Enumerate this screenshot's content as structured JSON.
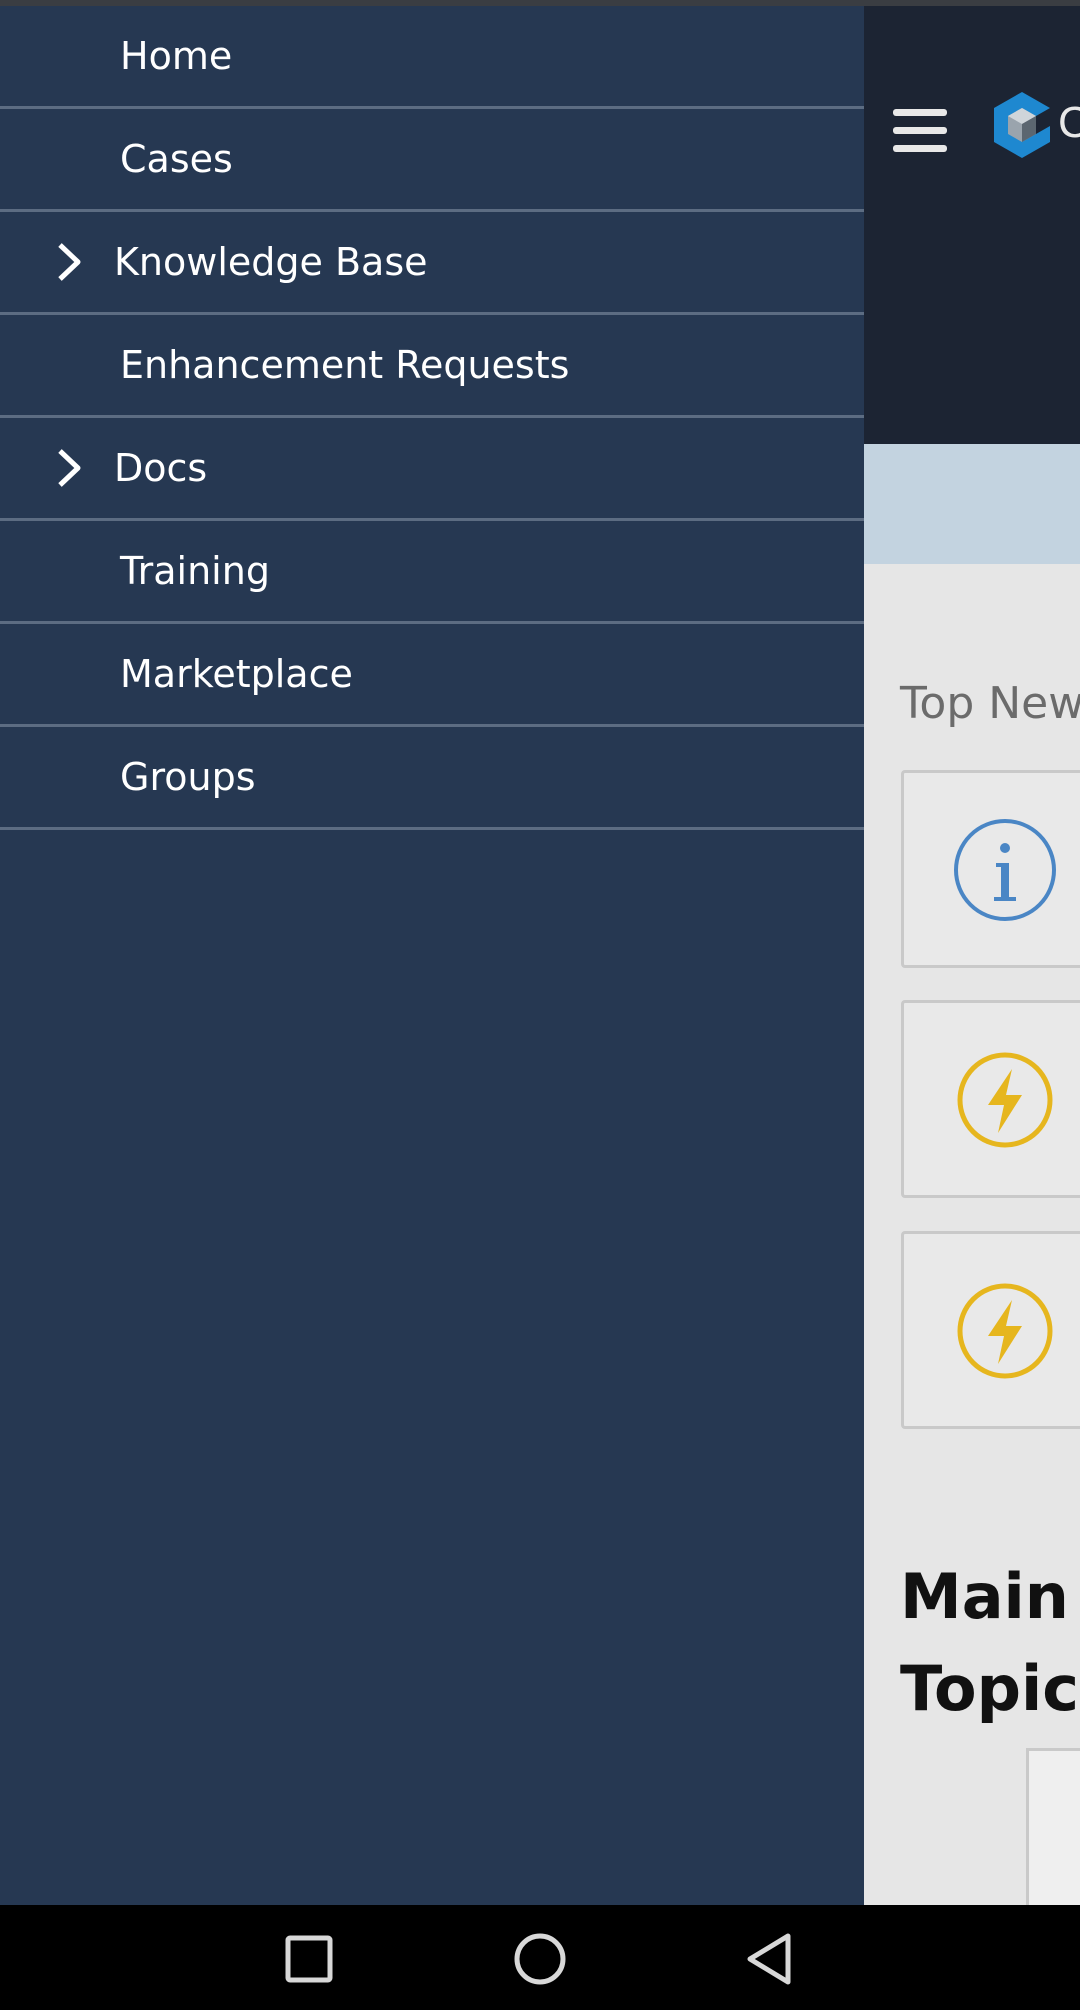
{
  "drawer": {
    "items": [
      {
        "label": "Home",
        "expandable": false
      },
      {
        "label": "Cases",
        "expandable": false
      },
      {
        "label": "Knowledge Base",
        "expandable": true
      },
      {
        "label": "Enhancement Requests",
        "expandable": false
      },
      {
        "label": "Docs",
        "expandable": true
      },
      {
        "label": "Training",
        "expandable": false
      },
      {
        "label": "Marketplace",
        "expandable": false
      },
      {
        "label": "Groups",
        "expandable": false
      }
    ]
  },
  "page": {
    "logo_letter": "C",
    "section_top_news": "Top New",
    "section_main_topics_line1": "Main",
    "section_main_topics_line2": "Topics",
    "news_cards": [
      {
        "icon": "info-icon",
        "color": "#4a86c5"
      },
      {
        "icon": "lightning-icon",
        "color": "#e6b61e"
      },
      {
        "icon": "lightning-icon",
        "color": "#e6b61e"
      }
    ]
  },
  "colors": {
    "drawer_bg": "#263852",
    "header_bg": "#1c2433",
    "band_bg": "#c3d3e0",
    "logo_blue": "#1e88d0"
  }
}
